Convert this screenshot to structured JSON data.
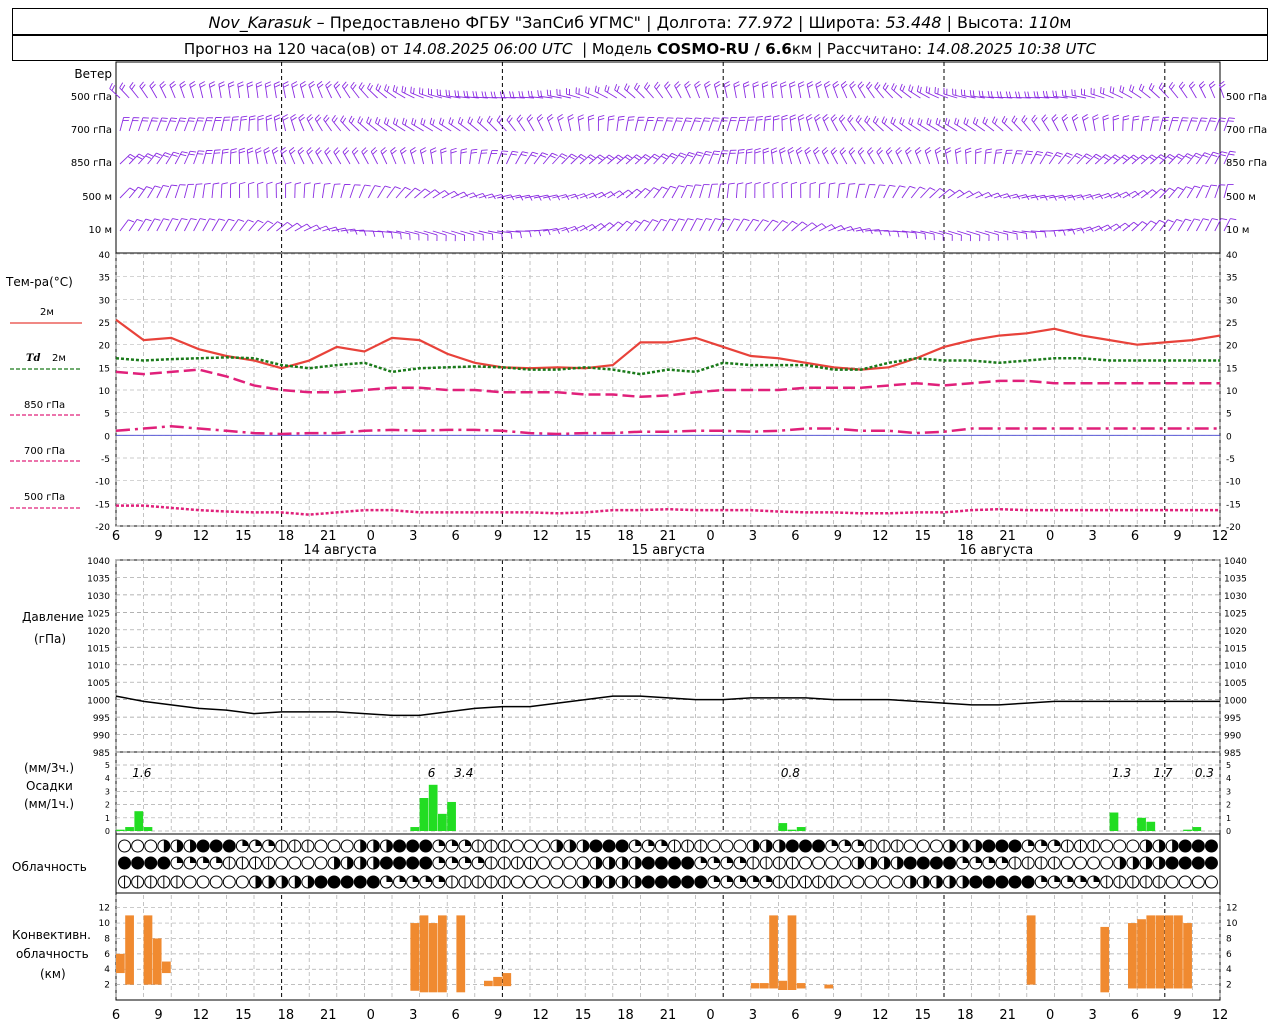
{
  "header": {
    "station": "Nov_Karasuk",
    "provider": "Предоставлено ФГБУ \"ЗапСиб УГМС\"",
    "lon_label": "Долгота:",
    "lon": "77.972",
    "lat_label": "Широта:",
    "lat": "53.448",
    "alt_label": "Высота:",
    "alt": "110",
    "alt_unit": "м",
    "forecast_label": "Прогноз на 120 часа(ов) от",
    "init_time": "14.08.2025 06:00 UTC",
    "model_label": "Модель",
    "model": "COSMO-RU / 6.6",
    "model_unit": "км",
    "computed_label": "Рассчитано:",
    "computed_time": "14.08.2025 10:38 UTC"
  },
  "labels": {
    "wind": "Ветер",
    "temp": "Тем-ра(°C)",
    "temp_2m": "2м",
    "td": "Td",
    "td_2m": "2м",
    "t850": "850 гПа",
    "t700": "700 гПа",
    "t500": "500 гПа",
    "pressure": "Давление",
    "pressure_unit": "(гПа)",
    "precip_unit3": "(мм/3ч.)",
    "precip": "Осадки",
    "precip_unit1": "(мм/1ч.)",
    "cloud": "Облачность",
    "conv1": "Конвективн.",
    "conv2": "облачность",
    "conv3": "(км)"
  },
  "colors": {
    "t2m": "#e8423a",
    "td": "#1a7a1a",
    "t850": "#e0207a",
    "t700": "#e0207a",
    "t500": "#e0207a",
    "wind": "#8a2be2",
    "precip": "#22dd22",
    "convective": "#f08a30",
    "pressure": "#000000"
  },
  "chart_data": [
    {
      "type": "barbs",
      "title": "Ветер",
      "levels": [
        "500 гПа",
        "700 гПа",
        "850 гПа",
        "500 м",
        "10  м"
      ],
      "hours": [
        0,
        120
      ],
      "note_barb_density": "hourly"
    },
    {
      "type": "line",
      "title": "Тем-ра(°C)",
      "ylim": [
        -20,
        40
      ],
      "yticks": [
        40,
        35,
        30,
        25,
        20,
        15,
        10,
        5,
        0,
        -5,
        -10,
        -15,
        -20
      ],
      "x_hours_from_init": [
        0,
        3,
        6,
        9,
        12,
        15,
        18,
        21,
        24,
        27,
        30,
        33,
        36,
        39,
        42,
        45,
        48,
        51,
        54,
        57,
        60,
        63,
        66,
        69,
        72,
        75,
        78,
        81,
        84,
        87,
        90,
        93,
        96,
        99,
        102,
        105,
        108,
        111,
        114,
        117,
        120
      ],
      "series": [
        {
          "name": "2м",
          "key": "t2m",
          "values": [
            25.5,
            21,
            21.5,
            19,
            17.5,
            16.5,
            14.8,
            16.5,
            19.5,
            18.5,
            21.5,
            21,
            18,
            16,
            15,
            14.8,
            15,
            14.8,
            15.5,
            20.5,
            20.5,
            21.5,
            19.5,
            17.5,
            17,
            16,
            15,
            14.5,
            15,
            17,
            19.5,
            21,
            22,
            22.5,
            23.5,
            22,
            21,
            20,
            20.5,
            21,
            22
          ]
        },
        {
          "name": "Td 2м",
          "key": "td",
          "values": [
            17,
            16.5,
            16.8,
            17,
            17.2,
            17,
            15.5,
            14.8,
            15.5,
            16,
            14,
            14.8,
            15,
            15.2,
            15,
            14.5,
            14.5,
            15,
            14.5,
            13.5,
            14.5,
            14,
            16,
            15.5,
            15.5,
            15.5,
            14.5,
            14.5,
            16,
            17,
            16.5,
            16.5,
            16,
            16.5,
            17,
            17,
            16.5,
            16.5,
            16.5,
            16.5,
            16.5
          ]
        },
        {
          "name": "850 гПа",
          "key": "t850",
          "values": [
            14,
            13.5,
            14,
            14.5,
            13,
            11,
            10,
            9.5,
            9.5,
            10,
            10.5,
            10.5,
            10,
            10,
            9.5,
            9.5,
            9.5,
            9,
            9,
            8.5,
            8.8,
            9.5,
            10,
            10,
            10,
            10.5,
            10.5,
            10.5,
            11,
            11.5,
            11,
            11.5,
            12,
            12,
            11.5,
            11.5,
            11.5,
            11.5,
            11.5,
            11.5,
            11.5
          ]
        },
        {
          "name": "700 гПа",
          "key": "t700",
          "values": [
            1,
            1.5,
            2,
            1.5,
            1,
            0.5,
            0.3,
            0.5,
            0.5,
            1,
            1.2,
            1,
            1.2,
            1.2,
            1,
            0.5,
            0.3,
            0.5,
            0.5,
            0.8,
            0.8,
            1,
            1,
            0.8,
            1,
            1.5,
            1.5,
            1,
            1,
            0.5,
            0.8,
            1.5,
            1.5,
            1.5,
            1.5,
            1.5,
            1.5,
            1.5,
            1.5,
            1.5,
            1.5
          ]
        },
        {
          "name": "500 гПа",
          "key": "t500",
          "values": [
            -15.5,
            -15.5,
            -16,
            -16.5,
            -16.8,
            -17,
            -17,
            -17.5,
            -17,
            -16.5,
            -16.5,
            -17,
            -17,
            -17,
            -17,
            -17,
            -17.2,
            -17,
            -16.5,
            -16.5,
            -16.3,
            -16.5,
            -16.5,
            -16.5,
            -16.8,
            -17,
            -17,
            -17.2,
            -17.2,
            -17,
            -17,
            -16.5,
            -16.3,
            -16.5,
            -16.5,
            -16.5,
            -16.5,
            -16.5,
            -16.5,
            -16.5,
            -16.5
          ]
        }
      ]
    },
    {
      "type": "line",
      "title": "Давление",
      "ylabel": "(гПа)",
      "ylim": [
        985,
        1040
      ],
      "yticks": [
        1040,
        1035,
        1030,
        1025,
        1020,
        1015,
        1010,
        1005,
        1000,
        995,
        990,
        985
      ],
      "series": [
        {
          "name": "pressure",
          "values": [
            1001,
            999.5,
            998.5,
            997.5,
            997,
            996,
            996.5,
            996.5,
            996.5,
            996,
            995.5,
            995.5,
            996.5,
            997.5,
            998,
            998,
            999,
            1000,
            1001,
            1001,
            1000.5,
            1000,
            1000,
            1000.5,
            1000.5,
            1000.5,
            1000,
            1000,
            1000,
            999.5,
            999,
            998.5,
            998.5,
            999,
            999.5,
            999.5,
            999.5,
            999.5,
            999.5,
            999.5,
            999.5
          ]
        }
      ]
    },
    {
      "type": "bar",
      "title": "Осадки",
      "ylim": [
        0,
        5
      ],
      "yticks": [
        5,
        4,
        3,
        2,
        1,
        0
      ],
      "totals_3h": [
        {
          "hour": 1.5,
          "label": "1.6"
        },
        {
          "hour": 33,
          "label": "6"
        },
        {
          "hour": 36.5,
          "label": "3.4"
        },
        {
          "hour": 72,
          "label": "0.8"
        },
        {
          "hour": 108,
          "label": "1.3"
        },
        {
          "hour": 112.5,
          "label": "1.7"
        },
        {
          "hour": 117,
          "label": "0.3"
        }
      ],
      "bars": [
        {
          "hour": 0,
          "value": 0.1
        },
        {
          "hour": 1,
          "value": 0.3
        },
        {
          "hour": 2,
          "value": 1.5
        },
        {
          "hour": 3,
          "value": 0.3
        },
        {
          "hour": 32,
          "value": 0.3
        },
        {
          "hour": 33,
          "value": 2.5
        },
        {
          "hour": 34,
          "value": 3.5
        },
        {
          "hour": 35,
          "value": 1.3
        },
        {
          "hour": 36,
          "value": 2.2
        },
        {
          "hour": 72,
          "value": 0.6
        },
        {
          "hour": 73,
          "value": 0.1
        },
        {
          "hour": 74,
          "value": 0.3
        },
        {
          "hour": 108,
          "value": 1.4
        },
        {
          "hour": 111,
          "value": 1.0
        },
        {
          "hour": 112,
          "value": 0.7
        },
        {
          "hour": 116,
          "value": 0.1
        },
        {
          "hour": 117,
          "value": 0.3
        }
      ]
    },
    {
      "type": "symbols",
      "title": "Облачность",
      "rows": [
        "high",
        "middle",
        "low"
      ],
      "symbols_per_row": 84
    },
    {
      "type": "bar",
      "title": "Конвективн. облачность (км)",
      "ylim": [
        0,
        13
      ],
      "yticks": [
        12,
        10,
        8,
        6,
        4,
        2
      ],
      "ranges_km": [
        {
          "hour": 0,
          "bottom": 3.5,
          "top": 6
        },
        {
          "hour": 1,
          "bottom": 2,
          "top": 11
        },
        {
          "hour": 3,
          "bottom": 2,
          "top": 11
        },
        {
          "hour": 4,
          "bottom": 2,
          "top": 8
        },
        {
          "hour": 5,
          "bottom": 3.5,
          "top": 5
        },
        {
          "hour": 32,
          "bottom": 1.2,
          "top": 10
        },
        {
          "hour": 33,
          "bottom": 1,
          "top": 11
        },
        {
          "hour": 34,
          "bottom": 1,
          "top": 10
        },
        {
          "hour": 35,
          "bottom": 1,
          "top": 11
        },
        {
          "hour": 37,
          "bottom": 1,
          "top": 11
        },
        {
          "hour": 40,
          "bottom": 1.8,
          "top": 2.5
        },
        {
          "hour": 41,
          "bottom": 1.8,
          "top": 3
        },
        {
          "hour": 42,
          "bottom": 1.8,
          "top": 3.5
        },
        {
          "hour": 69,
          "bottom": 1.5,
          "top": 2.2
        },
        {
          "hour": 70,
          "bottom": 1.5,
          "top": 2.2
        },
        {
          "hour": 71,
          "bottom": 1.5,
          "top": 11
        },
        {
          "hour": 72,
          "bottom": 1.3,
          "top": 2.5
        },
        {
          "hour": 73,
          "bottom": 1.3,
          "top": 11
        },
        {
          "hour": 74,
          "bottom": 1.5,
          "top": 2.2
        },
        {
          "hour": 77,
          "bottom": 1.5,
          "top": 2
        },
        {
          "hour": 99,
          "bottom": 2,
          "top": 11
        },
        {
          "hour": 107,
          "bottom": 1,
          "top": 9.5
        },
        {
          "hour": 110,
          "bottom": 1.5,
          "top": 10
        },
        {
          "hour": 111,
          "bottom": 1.5,
          "top": 10.5
        },
        {
          "hour": 112,
          "bottom": 1.5,
          "top": 11
        },
        {
          "hour": 113,
          "bottom": 1.5,
          "top": 11
        },
        {
          "hour": 114,
          "bottom": 1.5,
          "top": 11
        },
        {
          "hour": 115,
          "bottom": 1.5,
          "top": 11
        },
        {
          "hour": 116,
          "bottom": 1.5,
          "top": 10
        }
      ]
    }
  ],
  "time_axis": {
    "hour_labels": [
      "6",
      "9",
      "12",
      "15",
      "18",
      "21",
      "0",
      "3",
      "6",
      "9",
      "12",
      "15",
      "18",
      "21",
      "0",
      "3",
      "6",
      "9",
      "12",
      "15",
      "18",
      "21",
      "0",
      "3",
      "6",
      "9",
      "12"
    ],
    "day_labels": [
      "14 августа",
      "15 августа",
      "16 августа"
    ]
  }
}
